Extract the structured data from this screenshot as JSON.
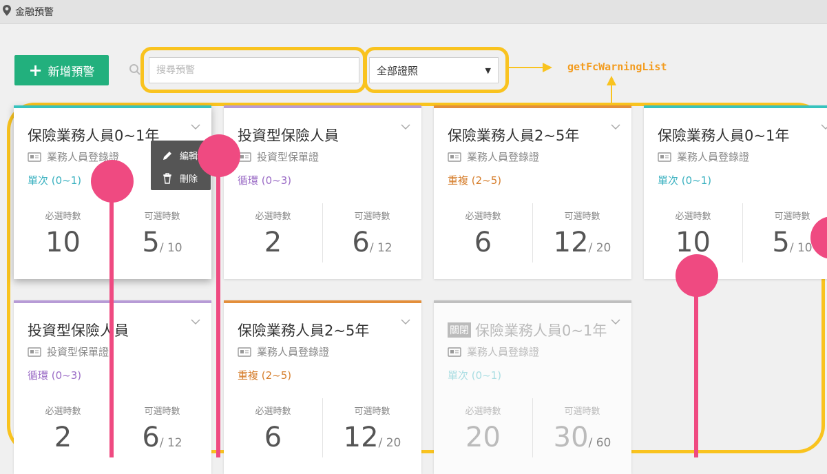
{
  "topbar": {
    "title": "金融預警",
    "icon": "map-pin-icon"
  },
  "toolbar": {
    "add_label": "新增預警",
    "search_placeholder": "搜尋預警",
    "filter_value": "全部證照",
    "caret": "▼"
  },
  "annotation": {
    "api_label": "getFcWarningList",
    "color": "#f9c31f"
  },
  "menu": {
    "edit_label": "編輯",
    "delete_label": "刪除"
  },
  "labels": {
    "required": "必選時數",
    "optional": "可選時數"
  },
  "cards": [
    {
      "title": "保險業務人員0~1年",
      "cert": "業務人員登錄證",
      "freq": "單次 (0~1)",
      "required": "10",
      "optional": "5",
      "optional_total": "/ 10",
      "color": "#36c3be",
      "closed": false
    },
    {
      "title": "投資型保險人員",
      "cert": "投資型保單證",
      "freq": "循環 (0~3)",
      "required": "2",
      "optional": "6",
      "optional_total": "/ 12",
      "color": "#b79bd6",
      "closed": false
    },
    {
      "title": "保險業務人員2~5年",
      "cert": "業務人員登錄證",
      "freq": "重複 (2~5)",
      "required": "6",
      "optional": "12",
      "optional_total": "/ 20",
      "color": "#e38f3b",
      "closed": false
    },
    {
      "title": "保險業務人員0~1年",
      "cert": "業務人員登錄證",
      "freq": "單次 (0~1)",
      "required": "10",
      "optional": "5",
      "optional_total": "/ 10",
      "color": "#36c3be",
      "closed": false
    },
    {
      "title": "投資型保險人員",
      "cert": "投資型保單證",
      "freq": "循環 (0~3)",
      "required": "2",
      "optional": "6",
      "optional_total": "/ 12",
      "color": "#b79bd6",
      "closed": false
    },
    {
      "title": "保險業務人員2~5年",
      "cert": "業務人員登錄證",
      "freq": "重複 (2~5)",
      "required": "6",
      "optional": "12",
      "optional_total": "/ 20",
      "color": "#e38f3b",
      "closed": false
    },
    {
      "title": "保險業務人員0~1年",
      "cert": "業務人員登錄證",
      "freq": "單次 (0~1)",
      "required": "20",
      "optional": "30",
      "optional_total": "/ 60",
      "color": "#bfbfbf",
      "closed": true,
      "closed_label": "關閉"
    }
  ]
}
